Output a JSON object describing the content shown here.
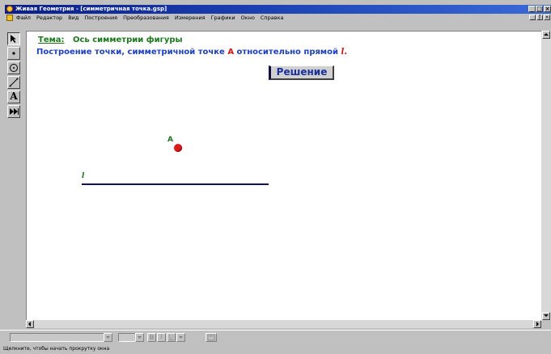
{
  "window": {
    "title": "Живая Геометрия - [симметричная точка.gsp]",
    "caption_buttons": [
      "_",
      "□",
      "×"
    ]
  },
  "menu": {
    "items": [
      "Файл",
      "Редактор",
      "Вид",
      "Построения",
      "Преобразования",
      "Измерения",
      "Графики",
      "Окно",
      "Справка"
    ],
    "doc_buttons": [
      "_",
      "ƒ",
      "×"
    ]
  },
  "toolbox": {
    "tools": [
      {
        "icon": "arrow-select-icon"
      },
      {
        "icon": "point-tool-icon"
      },
      {
        "icon": "compass-circle-icon"
      },
      {
        "icon": "straightedge-icon"
      },
      {
        "icon": "text-tool-icon",
        "glyph": "A"
      },
      {
        "icon": "custom-tool-icon"
      }
    ]
  },
  "sketch": {
    "topic_label": "Тема:",
    "topic_text": "Ось симметрии фигуры",
    "task_prefix": "Построение точки, симметричной точке ",
    "task_point": "А",
    "task_middle": " относительно прямой ",
    "task_line": "l",
    "task_end": ".",
    "solution_button": "Решение",
    "point_label": "A",
    "line_label": "l"
  },
  "format_bar": {
    "bold": "B",
    "italic": "I",
    "underline": "U"
  },
  "status": {
    "text": "Щелкните, чтобы начать прокрутку окна"
  },
  "colors": {
    "title_bar": "#0a1e8c",
    "topic_green": "#1a7a1a",
    "task_blue": "#1b3fd0",
    "accent_red": "#e01010",
    "line_navy": "#101060"
  }
}
